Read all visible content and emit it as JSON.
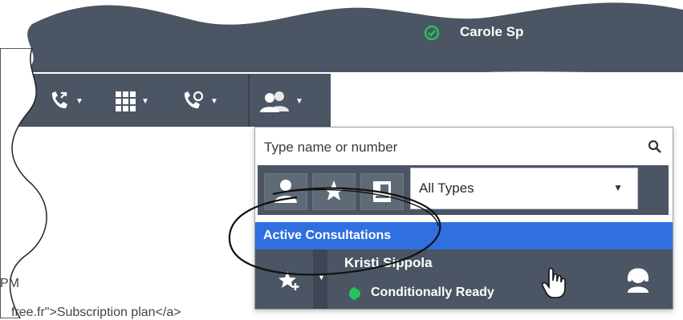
{
  "header": {
    "user_name": "Carole Sp",
    "user_status_color": "#22c55e",
    "background_color": "#4b5563"
  },
  "toolbar": {
    "buttons": [
      {
        "icon": "phone-transfer-icon"
      },
      {
        "icon": "keypad-grid-icon"
      },
      {
        "icon": "phone-consult-icon"
      },
      {
        "icon": "team-contacts-icon"
      }
    ]
  },
  "directory": {
    "search": {
      "placeholder": "Type name or number"
    },
    "filter_buttons": [
      {
        "icon": "person-icon"
      },
      {
        "icon": "star-icon"
      },
      {
        "icon": "contact-card-icon"
      }
    ],
    "type_select": {
      "selected": "All Types"
    },
    "section_title": "Active Consultations",
    "contacts": [
      {
        "name": "Kristi Sippola",
        "status": "Conditionally Ready",
        "status_color": "#22c55e"
      }
    ]
  },
  "background_text": {
    "time_fragment": "PM",
    "code_fragment": "free.fr\">Subscription plan</a>"
  },
  "colors": {
    "accent": "#2f6fe0",
    "panel_dark": "#4b5563"
  }
}
